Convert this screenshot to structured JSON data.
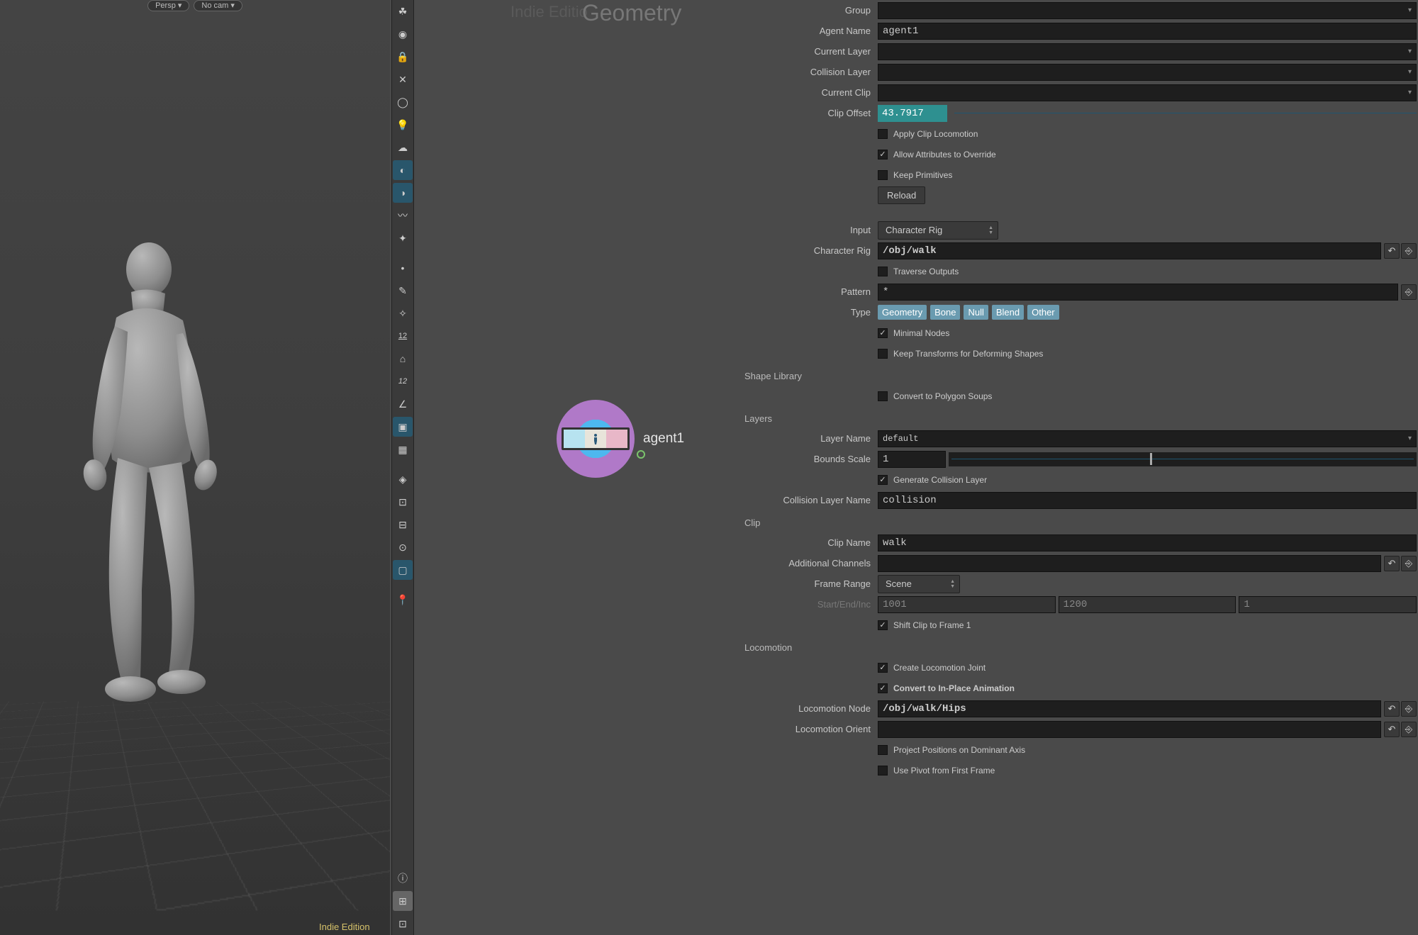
{
  "viewport": {
    "chip1": "Persp ▾",
    "chip2": "No cam ▾",
    "indie": "Indie Edition"
  },
  "network": {
    "tabPrefix": "Indie Editio",
    "tabMain": "Geometry",
    "nodeLabel": "agent1"
  },
  "params": {
    "group": {
      "label": "Group",
      "value": ""
    },
    "agentName": {
      "label": "Agent Name",
      "value": "agent1"
    },
    "currentLayer": {
      "label": "Current Layer",
      "value": ""
    },
    "collisionLayer": {
      "label": "Collision Layer",
      "value": ""
    },
    "currentClip": {
      "label": "Current Clip",
      "value": ""
    },
    "clipOffset": {
      "label": "Clip Offset",
      "value": "43.7917"
    },
    "applyClipLocomotion": "Apply Clip Locomotion",
    "allowOverride": "Allow Attributes to Override",
    "keepPrimitives": "Keep Primitives",
    "reload": "Reload",
    "input": {
      "label": "Input",
      "value": "Character Rig"
    },
    "characterRig": {
      "label": "Character Rig",
      "value": "/obj/walk"
    },
    "traverseOutputs": "Traverse Outputs",
    "pattern": {
      "label": "Pattern",
      "value": "*"
    },
    "type": {
      "label": "Type",
      "opts": [
        "Geometry",
        "Bone",
        "Null",
        "Blend",
        "Other"
      ]
    },
    "minimalNodes": "Minimal Nodes",
    "keepTransforms": "Keep Transforms for Deforming Shapes",
    "shapeLibrary": "Shape Library",
    "convertPolySoups": "Convert to Polygon Soups",
    "layers": "Layers",
    "layerName": {
      "label": "Layer Name",
      "value": "default"
    },
    "boundsScale": {
      "label": "Bounds Scale",
      "value": "1"
    },
    "genCollisionLayer": "Generate Collision Layer",
    "collisionLayerName": {
      "label": "Collision Layer Name",
      "value": "collision"
    },
    "clip": "Clip",
    "clipName": {
      "label": "Clip Name",
      "value": "walk"
    },
    "additionalChannels": {
      "label": "Additional Channels",
      "value": ""
    },
    "frameRange": {
      "label": "Frame Range",
      "value": "Scene"
    },
    "startEndInc": {
      "label": "Start/End/Inc",
      "v1": "1001",
      "v2": "1200",
      "v3": "1"
    },
    "shiftClip": "Shift Clip to Frame 1",
    "locomotion": "Locomotion",
    "createLocoJoint": "Create Locomotion Joint",
    "convertInPlace": "Convert to In-Place Animation",
    "locoNode": {
      "label": "Locomotion Node",
      "value": "/obj/walk/Hips"
    },
    "locoOrient": {
      "label": "Locomotion Orient",
      "value": ""
    },
    "projectPositions": "Project Positions on Dominant Axis",
    "usePivot": "Use Pivot from First Frame"
  }
}
